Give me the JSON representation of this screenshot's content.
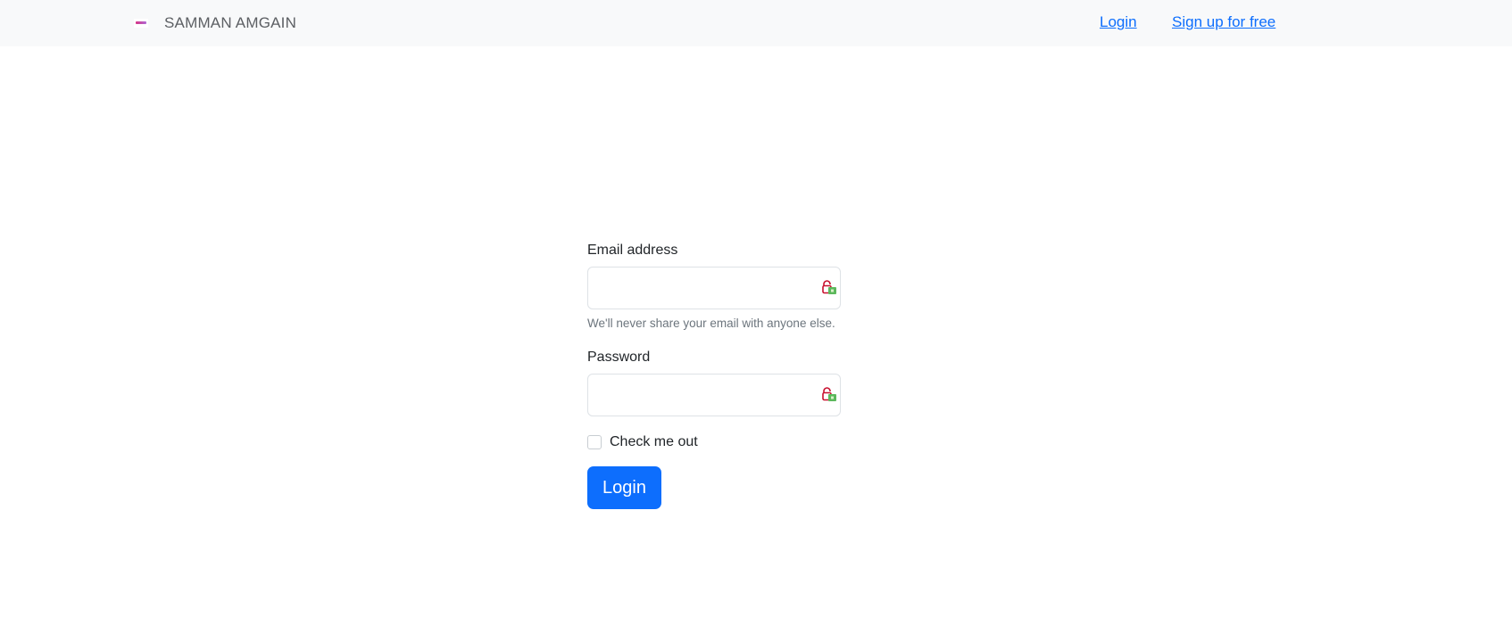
{
  "brand": {
    "name": "SAMMAN AMGAIN"
  },
  "nav": {
    "login": "Login",
    "signup": "Sign up for free"
  },
  "form": {
    "email_label": "Email address",
    "email_value": "",
    "email_help": "We'll never share your email with anyone else.",
    "password_label": "Password",
    "password_value": "",
    "checkbox_label": "Check me out",
    "checkbox_checked": false,
    "submit_label": "Login"
  },
  "colors": {
    "primary": "#0d6efd",
    "navbar_bg": "#f8f9fa",
    "muted_text": "#6c757d"
  }
}
